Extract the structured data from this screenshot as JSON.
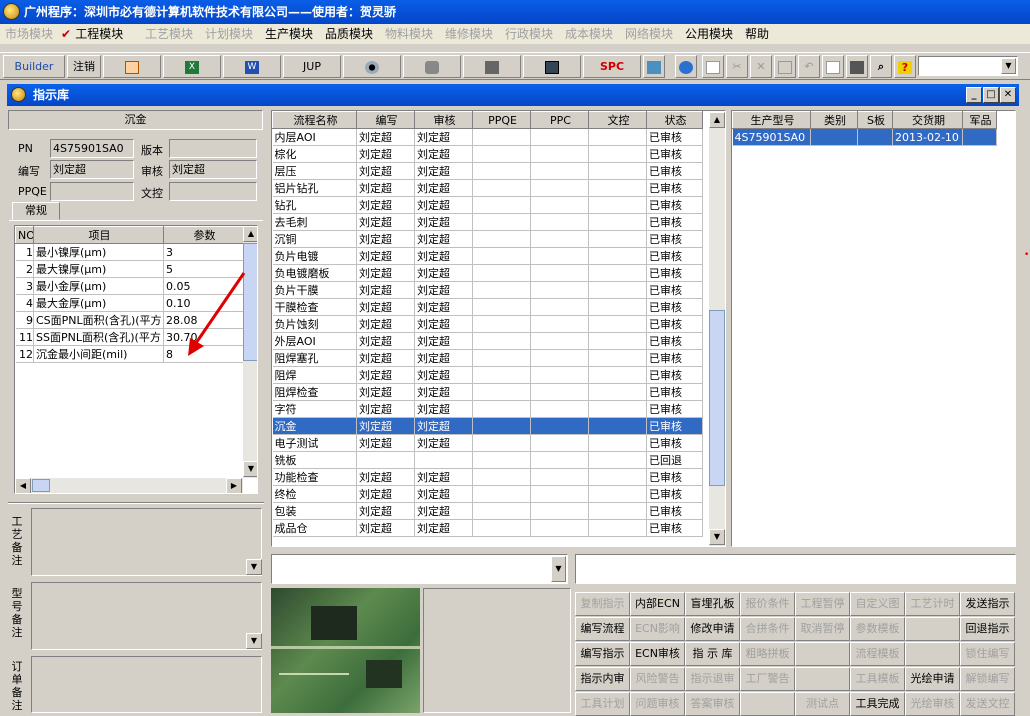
{
  "app": {
    "title": "广州程序：深圳市必有德计算机软件技术有限公司——使用者：贺灵骄"
  },
  "menu": [
    {
      "label": "市场模块",
      "enabled": false
    },
    {
      "label": "工程模块",
      "enabled": true,
      "checked": true
    },
    {
      "label": "工艺模块",
      "enabled": false
    },
    {
      "label": "计划模块",
      "enabled": false
    },
    {
      "label": "生产模块",
      "enabled": true
    },
    {
      "label": "品质模块",
      "enabled": true
    },
    {
      "label": "物料模块",
      "enabled": false
    },
    {
      "label": "维修模块",
      "enabled": false
    },
    {
      "label": "行政模块",
      "enabled": false
    },
    {
      "label": "成本模块",
      "enabled": false
    },
    {
      "label": "网络模块",
      "enabled": false
    },
    {
      "label": "公用模块",
      "enabled": true
    },
    {
      "label": "帮助",
      "enabled": true
    }
  ],
  "toolbar": {
    "builder": "Builder",
    "logout": "注销",
    "jup": "JUP",
    "spc": "SPC",
    "icons": [
      "open-tool-icon",
      "excel-icon",
      "word-icon",
      "eye-icon",
      "database-icon",
      "network-icon",
      "monitor-icon",
      "calculator-icon",
      "globe-icon",
      "new-doc-icon",
      "cut-icon",
      "delete-icon",
      "save-icon",
      "undo-icon",
      "preview-icon",
      "print-icon",
      "find-icon",
      "help-icon"
    ]
  },
  "window": {
    "title": "指示库"
  },
  "left": {
    "name": "沉金",
    "labels": {
      "pn": "PN",
      "version": "版本",
      "author": "编写",
      "reviewer": "审核",
      "ppqe": "PPQE",
      "doc": "文控"
    },
    "values": {
      "pn": "4S75901SA0",
      "version": "",
      "author": "刘定超",
      "reviewer": "刘定超",
      "ppqe": "",
      "doc": ""
    },
    "tab": "常规",
    "param_headers": [
      "NO",
      "项目",
      "参数"
    ],
    "params": [
      {
        "no": "1",
        "item": "最小镍厚(μm)",
        "value": "3"
      },
      {
        "no": "2",
        "item": "最大镍厚(μm)",
        "value": "5"
      },
      {
        "no": "3",
        "item": "最小金厚(μm)",
        "value": "0.05"
      },
      {
        "no": "4",
        "item": "最大金厚(μm)",
        "value": "0.10"
      },
      {
        "no": "9",
        "item": "CS面PNL面积(含孔)(平方",
        "value": "28.08"
      },
      {
        "no": "11",
        "item": "SS面PNL面积(含孔)(平方",
        "value": "30.70"
      },
      {
        "no": "12",
        "item": "沉金最小间距(mil)",
        "value": "8"
      }
    ],
    "notes": [
      "工艺备注",
      "型号备注",
      "订单备注"
    ]
  },
  "process": {
    "headers": [
      "流程名称",
      "编写",
      "审核",
      "PPQE",
      "PPC",
      "文控",
      "状态"
    ],
    "rows": [
      [
        "内层AOI",
        "刘定超",
        "刘定超",
        "",
        "",
        "",
        "已审核"
      ],
      [
        "棕化",
        "刘定超",
        "刘定超",
        "",
        "",
        "",
        "已审核"
      ],
      [
        "层压",
        "刘定超",
        "刘定超",
        "",
        "",
        "",
        "已审核"
      ],
      [
        "铝片钻孔",
        "刘定超",
        "刘定超",
        "",
        "",
        "",
        "已审核"
      ],
      [
        "钻孔",
        "刘定超",
        "刘定超",
        "",
        "",
        "",
        "已审核"
      ],
      [
        "去毛刺",
        "刘定超",
        "刘定超",
        "",
        "",
        "",
        "已审核"
      ],
      [
        "沉铜",
        "刘定超",
        "刘定超",
        "",
        "",
        "",
        "已审核"
      ],
      [
        "负片电镀",
        "刘定超",
        "刘定超",
        "",
        "",
        "",
        "已审核"
      ],
      [
        "负电镀磨板",
        "刘定超",
        "刘定超",
        "",
        "",
        "",
        "已审核"
      ],
      [
        "负片干膜",
        "刘定超",
        "刘定超",
        "",
        "",
        "",
        "已审核"
      ],
      [
        "干膜检查",
        "刘定超",
        "刘定超",
        "",
        "",
        "",
        "已审核"
      ],
      [
        "负片蚀刻",
        "刘定超",
        "刘定超",
        "",
        "",
        "",
        "已审核"
      ],
      [
        "外层AOI",
        "刘定超",
        "刘定超",
        "",
        "",
        "",
        "已审核"
      ],
      [
        "阻焊塞孔",
        "刘定超",
        "刘定超",
        "",
        "",
        "",
        "已审核"
      ],
      [
        "阻焊",
        "刘定超",
        "刘定超",
        "",
        "",
        "",
        "已审核"
      ],
      [
        "阻焊检查",
        "刘定超",
        "刘定超",
        "",
        "",
        "",
        "已审核"
      ],
      [
        "字符",
        "刘定超",
        "刘定超",
        "",
        "",
        "",
        "已审核"
      ],
      [
        "沉金",
        "刘定超",
        "刘定超",
        "",
        "",
        "",
        "已审核"
      ],
      [
        "电子测试",
        "刘定超",
        "刘定超",
        "",
        "",
        "",
        "已审核"
      ],
      [
        "铣板",
        "",
        "",
        "",
        "",
        "",
        "已回退"
      ],
      [
        "功能检查",
        "刘定超",
        "刘定超",
        "",
        "",
        "",
        "已审核"
      ],
      [
        "终检",
        "刘定超",
        "刘定超",
        "",
        "",
        "",
        "已审核"
      ],
      [
        "包装",
        "刘定超",
        "刘定超",
        "",
        "",
        "",
        "已审核"
      ],
      [
        "成品仓",
        "刘定超",
        "刘定超",
        "",
        "",
        "",
        "已审核"
      ]
    ],
    "selected_index": 17
  },
  "models": {
    "headers": [
      "生产型号",
      "类别",
      "S板",
      "交货期",
      "军品"
    ],
    "rows": [
      [
        "4S75901SA0",
        "",
        "",
        "2013-02-10",
        ""
      ]
    ]
  },
  "actions": [
    [
      {
        "label": "复制指示",
        "enabled": false
      },
      {
        "label": "内部ECN",
        "enabled": true
      },
      {
        "label": "盲埋孔板",
        "enabled": true
      },
      {
        "label": "报价条件",
        "enabled": false
      },
      {
        "label": "工程暂停",
        "enabled": false
      },
      {
        "label": "自定义图",
        "enabled": false
      },
      {
        "label": "工艺计时",
        "enabled": false
      },
      {
        "label": "发送指示",
        "enabled": true
      }
    ],
    [
      {
        "label": "编写流程",
        "enabled": true
      },
      {
        "label": "ECN影响",
        "enabled": false
      },
      {
        "label": "修改申请",
        "enabled": true
      },
      {
        "label": "合拼条件",
        "enabled": false
      },
      {
        "label": "取消暂停",
        "enabled": false
      },
      {
        "label": "参数模板",
        "enabled": false
      },
      {
        "label": "",
        "enabled": false
      },
      {
        "label": "回退指示",
        "enabled": true
      }
    ],
    [
      {
        "label": "编写指示",
        "enabled": true
      },
      {
        "label": "ECN审核",
        "enabled": true
      },
      {
        "label": "指 示 库",
        "enabled": true
      },
      {
        "label": "粗略拼板",
        "enabled": false
      },
      {
        "label": "",
        "enabled": false
      },
      {
        "label": "流程模板",
        "enabled": false
      },
      {
        "label": "",
        "enabled": false
      },
      {
        "label": "锁住编写",
        "enabled": false
      }
    ],
    [
      {
        "label": "指示内审",
        "enabled": true
      },
      {
        "label": "风险警告",
        "enabled": false
      },
      {
        "label": "指示退审",
        "enabled": false
      },
      {
        "label": "工厂警告",
        "enabled": false
      },
      {
        "label": "",
        "enabled": false
      },
      {
        "label": "工具模板",
        "enabled": false
      },
      {
        "label": "光绘申请",
        "enabled": true
      },
      {
        "label": "解锁编写",
        "enabled": false
      }
    ],
    [
      {
        "label": "工具计划",
        "enabled": false
      },
      {
        "label": "问题审核",
        "enabled": false
      },
      {
        "label": "答案审核",
        "enabled": false
      },
      {
        "label": "",
        "enabled": false
      },
      {
        "label": "测试点",
        "enabled": false
      },
      {
        "label": "工具完成",
        "enabled": true
      },
      {
        "label": "光绘审核",
        "enabled": false
      },
      {
        "label": "发送文控",
        "enabled": false
      }
    ]
  ],
  "colors": {
    "title_bar": "#0a5ee8",
    "selection": "#316ac5",
    "face": "#d4d0c8",
    "annotation_arrow": "#e00000"
  }
}
